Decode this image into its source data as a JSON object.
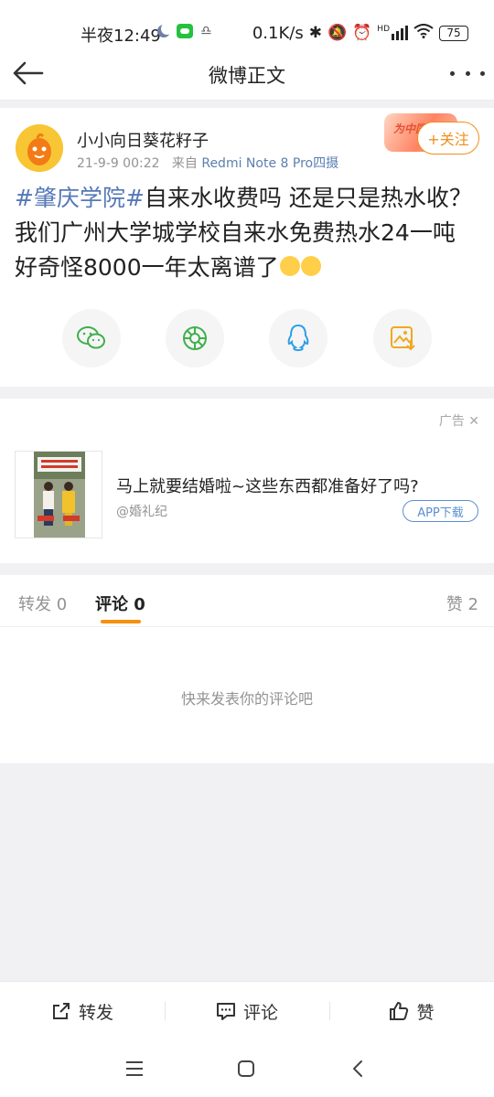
{
  "status_bar": {
    "time": "半夜12:49",
    "speed": "0.1K/s",
    "network_label": "HD",
    "battery": "75"
  },
  "nav": {
    "title": "微博正文"
  },
  "post": {
    "user_name": "小小向日葵花籽子",
    "date": "21-9-9 00:22",
    "via_label": "来自",
    "source": "Redmi Note 8 Pro四摄",
    "badge_text": "为中国",
    "follow_label": "+关注",
    "hashtag": "#肇庆学院#",
    "body_text": "自来水收费吗 还是只是热水收？ 我们广州大学城学校自来水免费热水24一吨 好奇怪8000一年太离谱了"
  },
  "ad": {
    "tag_label": "广告",
    "title": "马上就要结婚啦~这些东西都准备好了吗?",
    "source": "@婚礼纪",
    "app_button": "APP下载"
  },
  "tabs": {
    "repost_label": "转发",
    "repost_count": "0",
    "comment_label": "评论",
    "comment_count": "0",
    "like_label": "赞",
    "like_count": "2"
  },
  "comments": {
    "empty_hint": "快来发表你的评论吧"
  },
  "bottom_bar": {
    "repost": "转发",
    "comment": "评论",
    "like": "赞"
  },
  "colors": {
    "accent": "#f08f1b",
    "link": "#5578b8",
    "muted": "#939393"
  }
}
